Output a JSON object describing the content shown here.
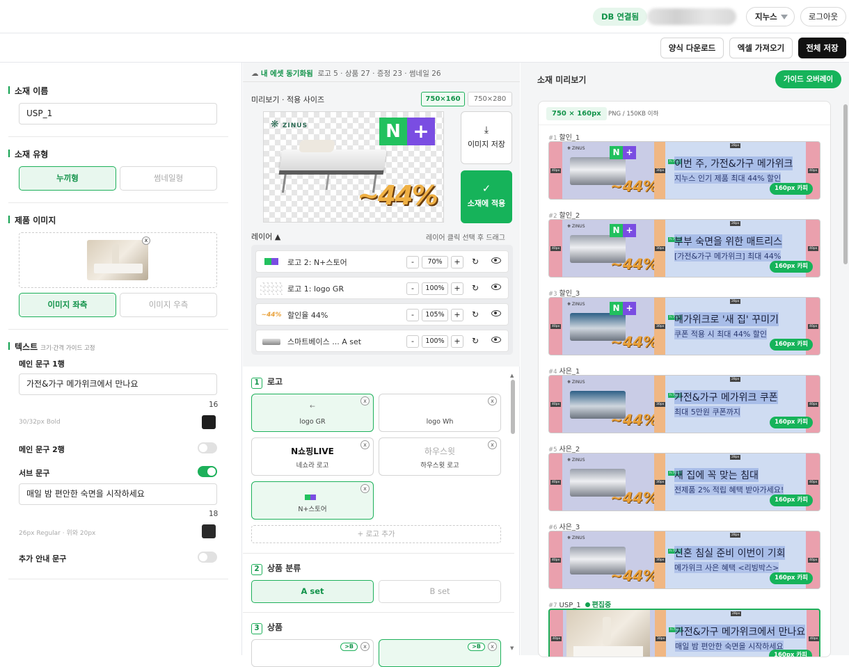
{
  "header": {
    "db_status": "DB 연결됨",
    "user_name": "지누스",
    "logout": "로그아웃"
  },
  "actions": {
    "download": "양식 다운로드",
    "import": "엑셀 가져오기",
    "save_all": "전체 저장"
  },
  "left": {
    "name_title": "소재 이름",
    "name_value": "USP_1",
    "type_title": "소재 유형",
    "type_options": [
      "누끼형",
      "썸네일형"
    ],
    "product_image_title": "제품 이미지",
    "image_pos_options": [
      "이미지 좌측",
      "이미지 우측"
    ],
    "text_title": "텍스트",
    "text_title_note": "크기·간격 가이드 고정",
    "main1_label": "메인 문구 1행",
    "main1_value": "가전&가구 메가위크에서 만나요",
    "main1_count": "16",
    "main1_hint": "30/32px Bold",
    "main2_label": "메인 문구 2행",
    "sub_label": "서브 문구",
    "sub_value": "매일 밤 편안한 숙면을 시작하세요",
    "sub_count": "18",
    "sub_hint": "26px Regular · 위와 20px",
    "extra_label": "추가 안내 문구",
    "colors": {
      "main1": "#1e1e1e",
      "sub": "#2a2a2a",
      "accent": "#1db05a"
    }
  },
  "mid": {
    "sync_label": "내 에셋 동기화됨",
    "sync_stats": "로고 5 · 상품 27 · 증정 23 · 썸네일 26",
    "preview_title": "미리보기 · 적용 사이즈",
    "sizes": [
      "750×160",
      "750×280"
    ],
    "preview_logo": "ZINUS",
    "preview_pct": "~44%",
    "save_image": "이미지 저장",
    "apply": "소재에 적용",
    "layers_title": "레이어 ▲",
    "layers_hint": "레이어 클릭 선택 후 드래그",
    "layers": [
      {
        "name": "로고 2: N+스토어",
        "pct": "70%"
      },
      {
        "name": "로고 1: logo GR",
        "pct": "100%"
      },
      {
        "name": "할인율 44%",
        "pct": "105%"
      },
      {
        "name": "스마트베이스 ... A set",
        "pct": "100%"
      }
    ],
    "group1": {
      "num": "1",
      "title": "로고"
    },
    "logo_cards": [
      {
        "label": "logo GR",
        "glyph": "←"
      },
      {
        "label": "logo Wh",
        "glyph": ""
      },
      {
        "label": "네쇼라 로고",
        "glyph": "N쇼핑LIVE"
      },
      {
        "label": "하우스윗 로고",
        "glyph": "하우스윗"
      },
      {
        "label": "N+스토어",
        "glyph": ""
      }
    ],
    "add_logo": "+ 로고 추가",
    "group2": {
      "num": "2",
      "title": "상품 분류"
    },
    "sets": [
      "A set",
      "B set"
    ],
    "group3": {
      "num": "3",
      "title": "상품"
    },
    "product_tag": ">B"
  },
  "right": {
    "title": "소재 미리보기",
    "guide_btn": "가이드 오버레이",
    "spec_badge": "750 × 160px",
    "spec_text": "PNG / 150KB 이하",
    "pill": "160px 카피",
    "editing": "편집중",
    "items": [
      {
        "idx": "#1",
        "name": "할인_1",
        "line1": "이번 주, 가전&가구 메가위크",
        "line2": "지누스 인기 제품 최대 44% 할인"
      },
      {
        "idx": "#2",
        "name": "할인_2",
        "line1": "부부 숙면을 위한 매트리스",
        "line2": "[가전&가구 메가위크] 최대 44%"
      },
      {
        "idx": "#3",
        "name": "할인_3",
        "line1": "메가위크로 '새 집' 꾸미기",
        "line2": "쿠폰 적용 시 최대 44% 할인"
      },
      {
        "idx": "#4",
        "name": "사은_1",
        "line1": "가전&가구 메가위크 쿠폰",
        "line2": "최대 5만원 쿠폰까지"
      },
      {
        "idx": "#5",
        "name": "사은_2",
        "line1": "새 집에 꼭 맞는 침대",
        "line2": "전제품 2% 적립 혜택 받아가세요!"
      },
      {
        "idx": "#6",
        "name": "사은_3",
        "line1": "신혼 침실 준비 이번이 기회",
        "line2": "메가위크 사은 혜택 <리빙박스>"
      },
      {
        "idx": "#7",
        "name": "USP_1",
        "line1": "가전&가구 메가위크에서 만나요",
        "line2": "매일 밤 편안한 숙면을 시작하세요"
      }
    ]
  }
}
